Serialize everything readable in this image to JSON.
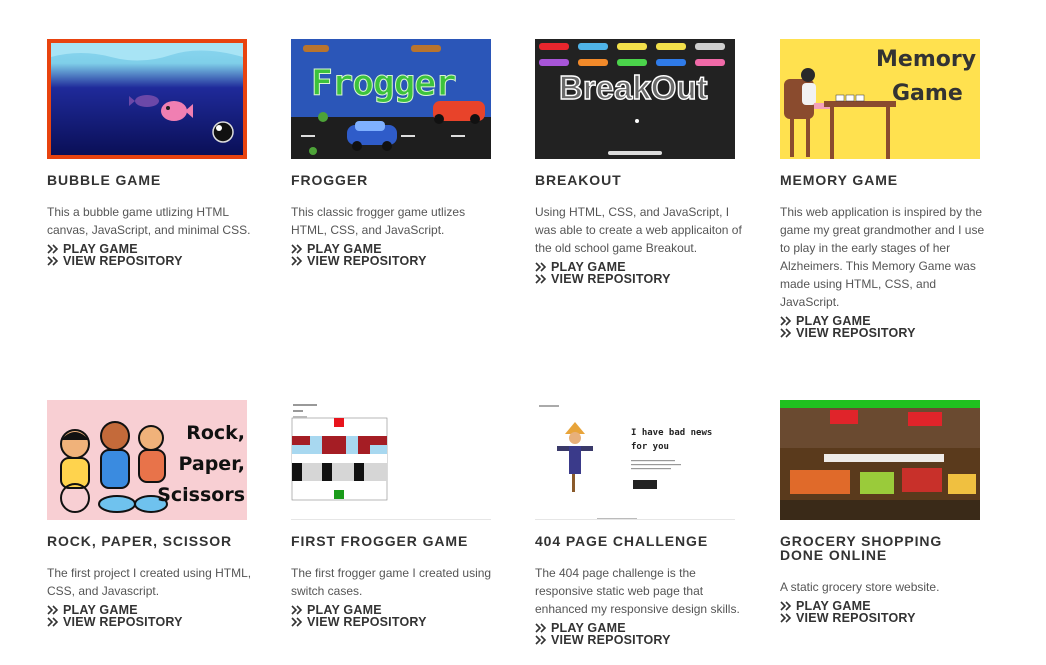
{
  "projects": [
    {
      "title": "BUBBLE GAME",
      "description": "This a bubble game utlizing HTML canvas, JavaScript, and minimal CSS.",
      "play_label": "PLAY GAME",
      "repo_label": "VIEW REPOSITORY"
    },
    {
      "title": "FROGGER",
      "description": "This classic frogger game utlizes HTML, CSS, and JavaScript.",
      "thumb_text": "Frogger",
      "play_label": "PLAY GAME",
      "repo_label": "VIEW REPOSITORY"
    },
    {
      "title": "BREAKOUT",
      "description": "Using HTML, CSS, and JavaScript, I was able to create a web applicaiton of the old school game Breakout.",
      "thumb_text": "BreakOut",
      "play_label": "PLAY GAME",
      "repo_label": "VIEW REPOSITORY"
    },
    {
      "title": "MEMORY GAME",
      "description": "This web application is inspired by the game my great grandmother and I use to play in the early stages of her Alzheimers. This Memory Game was made using HTML, CSS, and JavaScript.",
      "thumb_text_1": "Memory",
      "thumb_text_2": "Game",
      "play_label": "PLAY GAME",
      "repo_label": "VIEW REPOSITORY"
    },
    {
      "title": "ROCK, PAPER, SCISSOR",
      "description": "The first project I created using HTML, CSS, and Javascript.",
      "thumb_text_1": "Rock,",
      "thumb_text_2": "Paper,",
      "thumb_text_3": "Scissors",
      "play_label": "PLAY GAME",
      "repo_label": "VIEW REPOSITORY"
    },
    {
      "title": "FIRST FROGGER GAME",
      "description": "The first frogger game I created using switch cases.",
      "play_label": "PLAY GAME",
      "repo_label": "VIEW REPOSITORY"
    },
    {
      "title": "404 PAGE CHALLENGE",
      "description": "The 404 page challenge is the responsive static web page that enhanced my responsive design skills.",
      "thumb_text_1": "I have bad news",
      "thumb_text_2": "for you",
      "play_label": "PLAY GAME",
      "repo_label": "VIEW REPOSITORY"
    },
    {
      "title": "GROCERY SHOPPING DONE ONLINE",
      "description": "A static grocery store website.",
      "play_label": "PLAY GAME",
      "repo_label": "VIEW REPOSITORY"
    }
  ],
  "colors": {
    "title": "#333333",
    "text": "#555555",
    "bubble_border": "#e8430f",
    "frogger_bg": "#2b56b8",
    "breakout_bg": "#222222",
    "memory_bg": "#ffe14f",
    "rps_bg": "#f8cfd3"
  },
  "icons": {
    "link_icon": "double-chevron-right-icon"
  }
}
